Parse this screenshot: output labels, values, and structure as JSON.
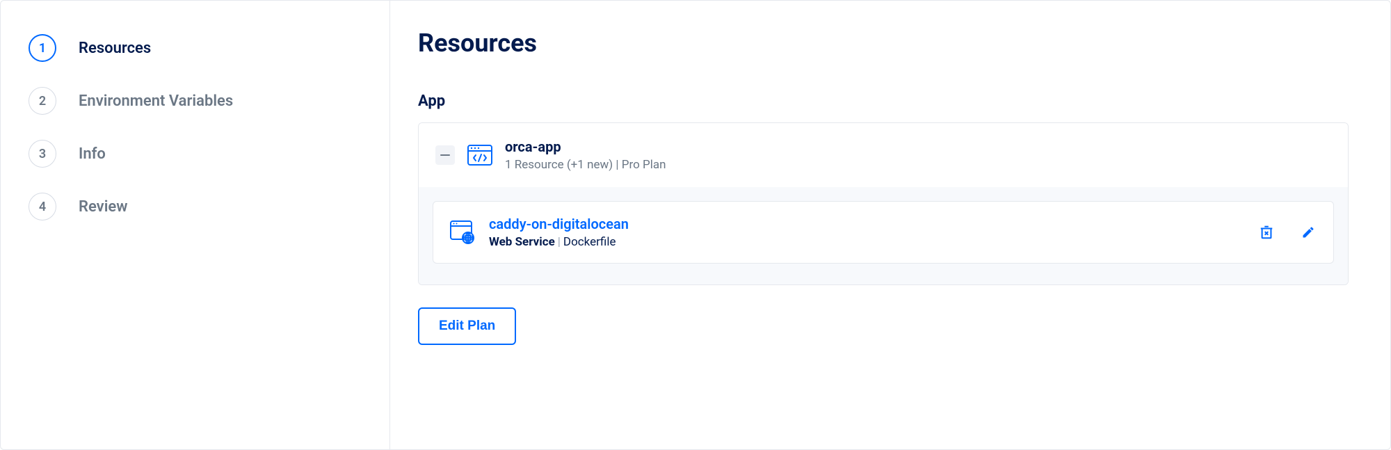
{
  "steps": [
    {
      "num": "1",
      "label": "Resources",
      "active": true
    },
    {
      "num": "2",
      "label": "Environment Variables",
      "active": false
    },
    {
      "num": "3",
      "label": "Info",
      "active": false
    },
    {
      "num": "4",
      "label": "Review",
      "active": false
    }
  ],
  "main": {
    "title": "Resources",
    "section_label": "App",
    "app": {
      "name": "orca-app",
      "meta": "1 Resource (+1 new) | Pro Plan"
    },
    "resource": {
      "name": "caddy-on-digitalocean",
      "type": "Web Service",
      "source": "Dockerfile"
    },
    "edit_plan_label": "Edit Plan"
  }
}
